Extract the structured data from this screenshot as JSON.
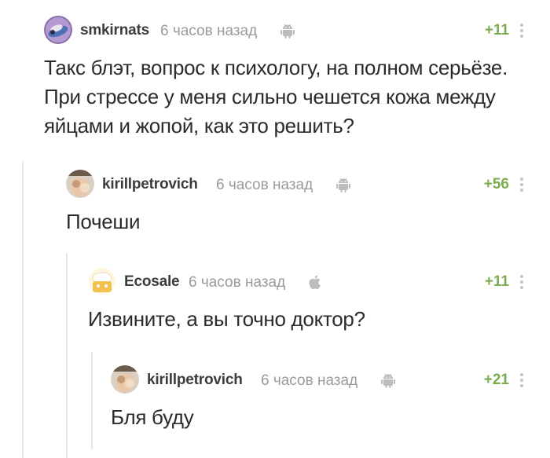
{
  "comments": [
    {
      "username": "smkirnats",
      "timestamp": "6 часов назад",
      "platform_icon": "android-icon",
      "rating": "+11",
      "text": "Такс блэт, вопрос к психологу, на полном серьёзе. При стрессе у меня сильно чешется кожа между яйцами и жопой, как это решить?"
    },
    {
      "username": "kirillpetrovich",
      "timestamp": "6 часов назад",
      "platform_icon": "android-icon",
      "rating": "+56",
      "text": "Почеши"
    },
    {
      "username": "Ecosale",
      "timestamp": "6 часов назад",
      "platform_icon": "apple-icon",
      "rating": "+11",
      "text": "Извините, а вы точно доктор?"
    },
    {
      "username": "kirillpetrovich",
      "timestamp": "6 часов назад",
      "platform_icon": "android-icon",
      "rating": "+21",
      "text": "Бля буду"
    }
  ],
  "colors": {
    "rating": "#7bae4e",
    "username": "#3c3c3c",
    "timestamp": "#9a9a9a",
    "thread_line": "#e6e6e6"
  }
}
